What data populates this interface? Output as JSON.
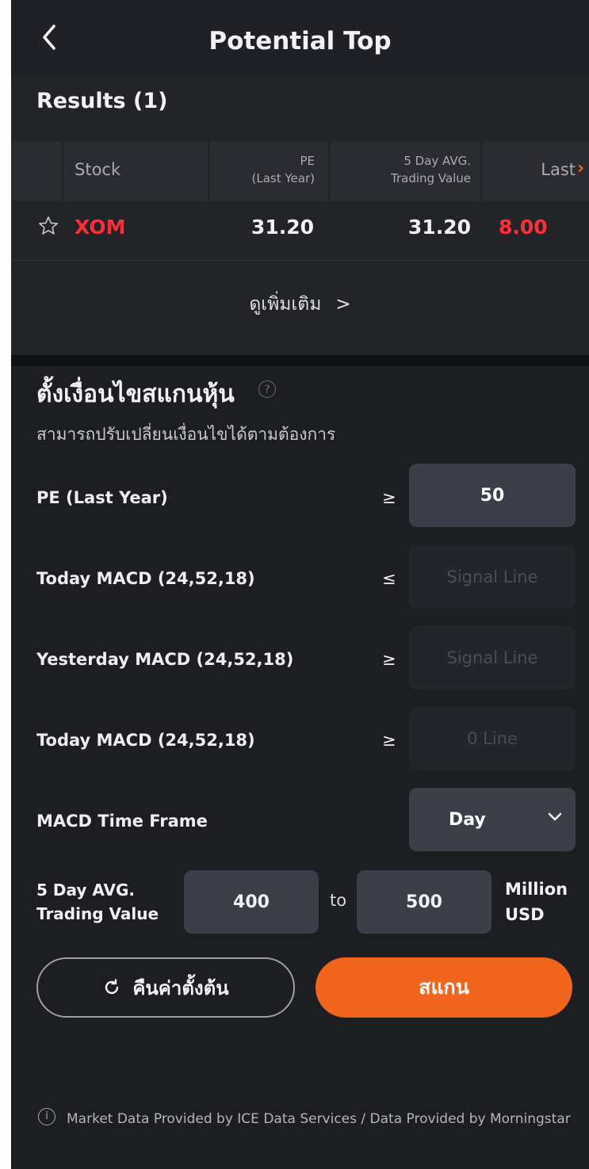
{
  "header": {
    "title": "Potential Top",
    "back_icon": "chevron-left-icon"
  },
  "results": {
    "title": "Results (1)",
    "columns": {
      "stock": "Stock",
      "pe_line1": "PE",
      "pe_line2": "(Last Year)",
      "avg_line1": "5 Day AVG.",
      "avg_line2": "Trading Value",
      "last": "Last"
    },
    "rows": [
      {
        "symbol": "XOM",
        "pe": "31.20",
        "avg_trading_value": "31.20",
        "last": "8.00"
      }
    ],
    "more_label": "ดูเพิ่มเติม"
  },
  "conditions": {
    "title": "ตั้งเงื่อนไขสแกนหุ้น",
    "subtitle": "สามารถปรับเปลี่ยนเงื่อนไขได้ตามต้องการ",
    "items": [
      {
        "label": "PE (Last Year)",
        "operator": "≥",
        "value": "50",
        "enabled": true
      },
      {
        "label": "Today MACD (24,52,18)",
        "operator": "≤",
        "value": "Signal Line",
        "enabled": false
      },
      {
        "label": "Yesterday MACD (24,52,18)",
        "operator": "≥",
        "value": "Signal Line",
        "enabled": false
      },
      {
        "label": "Today MACD (24,52,18)",
        "operator": "≥",
        "value": "0 Line",
        "enabled": false
      }
    ],
    "timeframe": {
      "label": "MACD Time Frame",
      "value": "Day"
    },
    "trading_value": {
      "label_line1": "5 Day AVG.",
      "label_line2": "Trading Value",
      "min": "400",
      "to": "to",
      "max": "500",
      "unit_line1": "Million",
      "unit_line2": "USD"
    }
  },
  "buttons": {
    "reset": "คืนค่าตั้งต้น",
    "scan": "สแกน"
  },
  "footer": {
    "text": "Market Data Provided by ICE Data Services / Data Provided by Morningstar"
  },
  "colors": {
    "accent": "#f0651b",
    "negative": "#ff2d3a",
    "background": "#1d1e22",
    "field": "#3d3f48"
  }
}
